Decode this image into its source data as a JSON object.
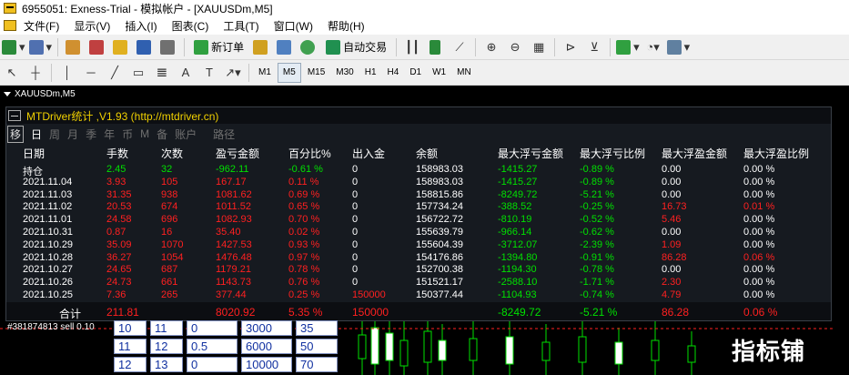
{
  "window": {
    "title": "6955051: Exness-Trial - 模拟帐户 - [XAUUSDm,M5]"
  },
  "menu": [
    "文件(F)",
    "显示(V)",
    "插入(I)",
    "图表(C)",
    "工具(T)",
    "窗口(W)",
    "帮助(H)"
  ],
  "toolbar": {
    "new_order": "新订单",
    "auto_trade": "自动交易"
  },
  "timeframes": [
    "M1",
    "M5",
    "M15",
    "M30",
    "H1",
    "H4",
    "D1",
    "W1",
    "MN"
  ],
  "tools": {
    "text_a": "A",
    "text_t": "T"
  },
  "chart": {
    "symbol": "XAUUSDm,M5",
    "order_label": "#381874813 sell 0.10"
  },
  "panel": {
    "title": "MTDriver统计 ,V1.93 (http://mtdriver.cn)",
    "tabs": [
      "移",
      "日",
      "周",
      "月",
      "季",
      "年",
      "币",
      "M",
      "备",
      "账户",
      "路径"
    ],
    "headers": [
      "日期",
      "手数",
      "次数",
      "盈亏金额",
      "百分比%",
      "出入金",
      "余额",
      "最大浮亏金额",
      "最大浮亏比例",
      "最大浮盈金额",
      "最大浮盈比例"
    ],
    "rows": [
      [
        "持仓",
        "2.45",
        "32",
        "-962.11",
        "-0.61 %",
        "0",
        "158983.03",
        "-1415.27",
        "-0.89 %",
        "0.00",
        "0.00 %"
      ],
      [
        "2021.11.04",
        "3.93",
        "105",
        "167.17",
        "0.11 %",
        "0",
        "158983.03",
        "-1415.27",
        "-0.89 %",
        "0.00",
        "0.00 %"
      ],
      [
        "2021.11.03",
        "31.35",
        "938",
        "1081.62",
        "0.69 %",
        "0",
        "158815.86",
        "-8249.72",
        "-5.21 %",
        "0.00",
        "0.00 %"
      ],
      [
        "2021.11.02",
        "20.53",
        "674",
        "1011.52",
        "0.65 %",
        "0",
        "157734.24",
        "-388.52",
        "-0.25 %",
        "16.73",
        "0.01 %"
      ],
      [
        "2021.11.01",
        "24.58",
        "696",
        "1082.93",
        "0.70 %",
        "0",
        "156722.72",
        "-810.19",
        "-0.52 %",
        "5.46",
        "0.00 %"
      ],
      [
        "2021.10.31",
        "0.87",
        "16",
        "35.40",
        "0.02 %",
        "0",
        "155639.79",
        "-966.14",
        "-0.62 %",
        "0.00",
        "0.00 %"
      ],
      [
        "2021.10.29",
        "35.09",
        "1070",
        "1427.53",
        "0.93 %",
        "0",
        "155604.39",
        "-3712.07",
        "-2.39 %",
        "1.09",
        "0.00 %"
      ],
      [
        "2021.10.28",
        "36.27",
        "1054",
        "1476.48",
        "0.97 %",
        "0",
        "154176.86",
        "-1394.80",
        "-0.91 %",
        "86.28",
        "0.06 %"
      ],
      [
        "2021.10.27",
        "24.65",
        "687",
        "1179.21",
        "0.78 %",
        "0",
        "152700.38",
        "-1194.30",
        "-0.78 %",
        "0.00",
        "0.00 %"
      ],
      [
        "2021.10.26",
        "24.73",
        "661",
        "1143.73",
        "0.76 %",
        "0",
        "151521.17",
        "-2588.10",
        "-1.71 %",
        "2.30",
        "0.00 %"
      ],
      [
        "2021.10.25",
        "7.36",
        "265",
        "377.44",
        "0.25 %",
        "150000",
        "150377.44",
        "-1104.93",
        "-0.74 %",
        "4.79",
        "0.00 %"
      ]
    ],
    "total": [
      "合计",
      "211.81",
      "",
      "8020.92",
      "5.35 %",
      "150000",
      "",
      "-8249.72",
      "-5.21 %",
      "86.28",
      "0.06 %"
    ]
  },
  "grid": [
    [
      "10",
      "11",
      "0",
      "3000",
      "35"
    ],
    [
      "11",
      "12",
      "0.5",
      "6000",
      "50"
    ],
    [
      "12",
      "13",
      "0",
      "10000",
      "70"
    ]
  ],
  "watermark": "指标铺"
}
